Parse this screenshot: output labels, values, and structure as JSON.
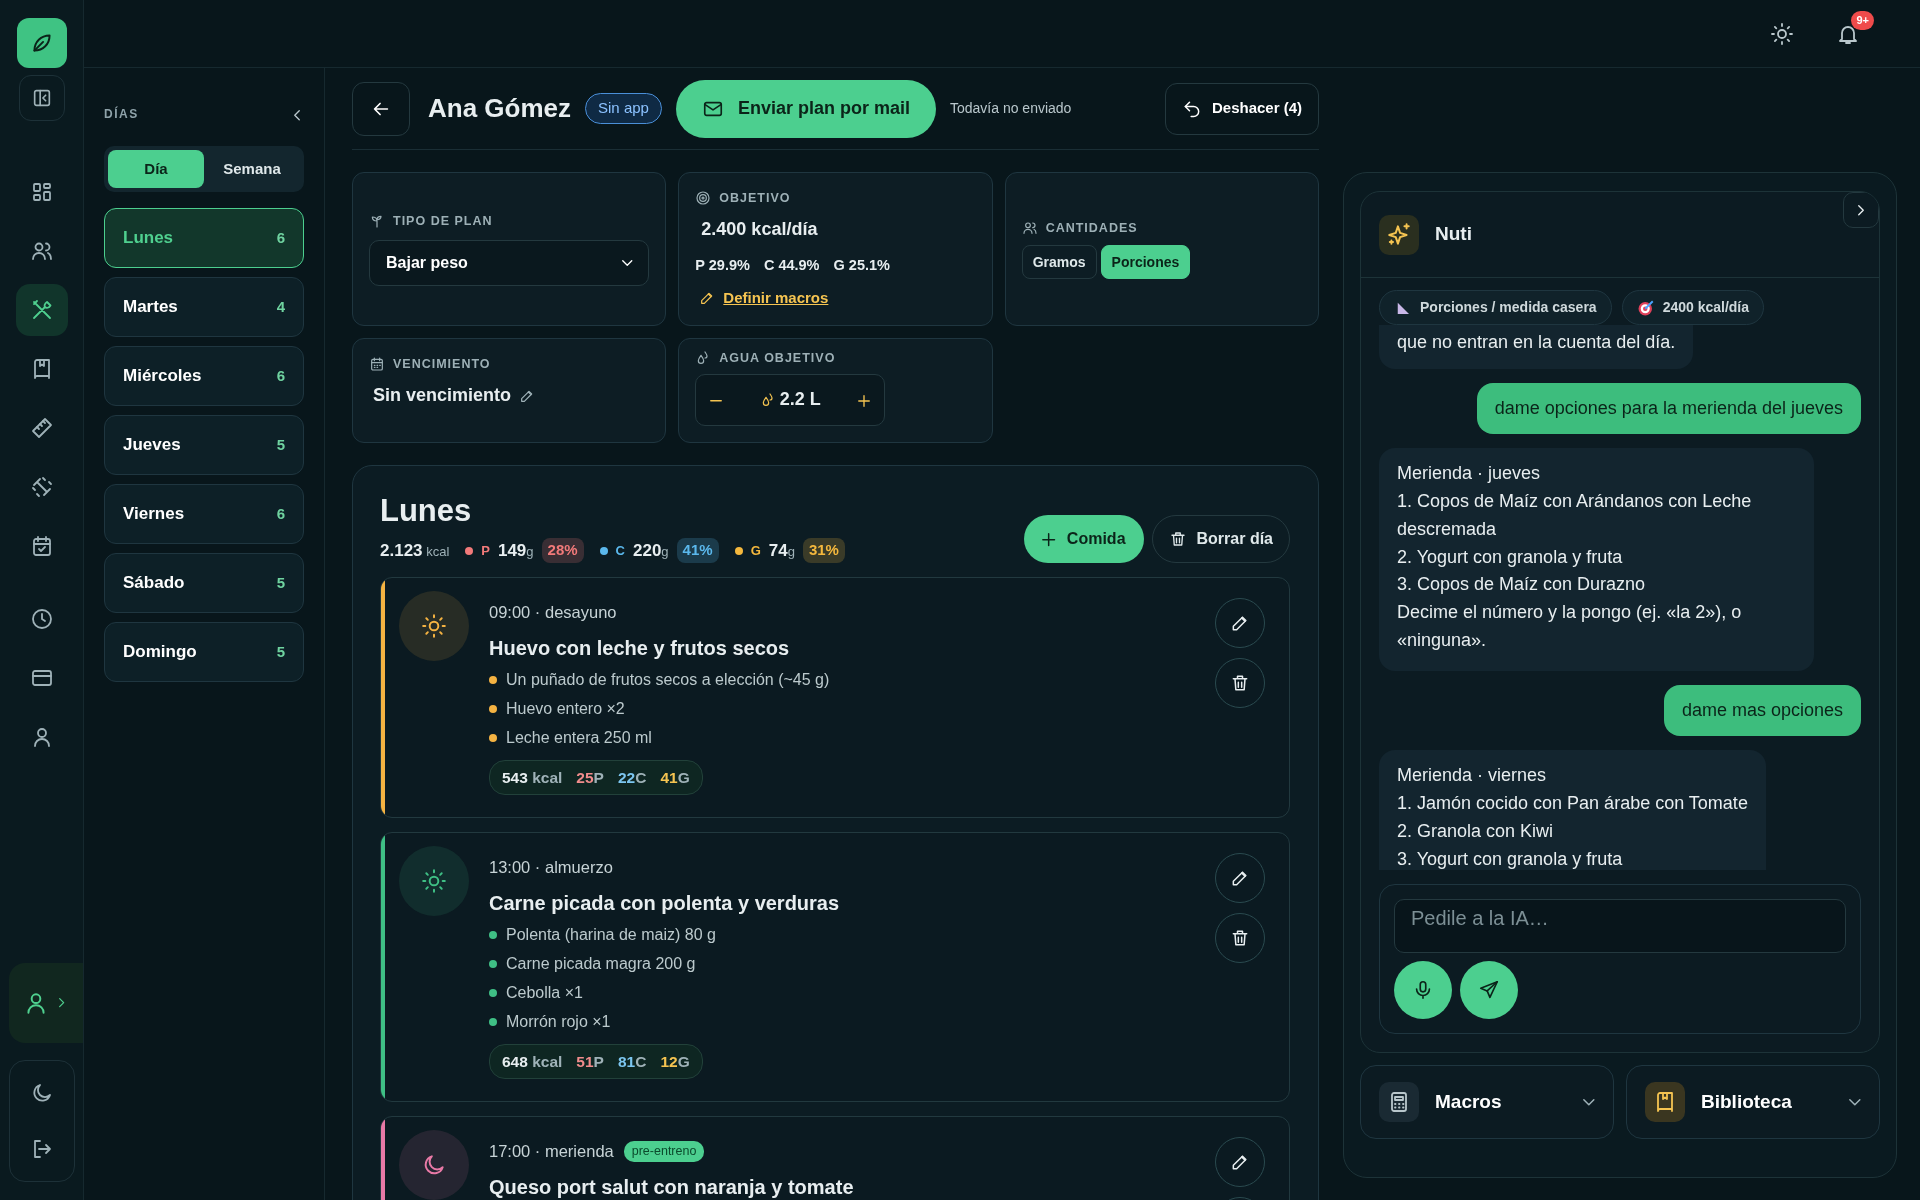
{
  "rail": {
    "items": [
      {
        "selected": false
      },
      {
        "selected": false
      },
      {
        "selected": true
      },
      {
        "selected": false
      },
      {
        "selected": false
      },
      {
        "selected": false
      },
      {
        "selected": false
      },
      {
        "selected": false
      },
      {
        "selected": false
      },
      {
        "selected": false
      }
    ]
  },
  "top_bar": {
    "notification_badge": "9+"
  },
  "days_panel": {
    "title": "DÍAS",
    "view_toggle": [
      {
        "label": "Día",
        "selected": true
      },
      {
        "label": "Semana",
        "selected": false
      }
    ],
    "days": [
      {
        "name": "Lunes",
        "count": "6",
        "selected": true
      },
      {
        "name": "Martes",
        "count": "4",
        "selected": false
      },
      {
        "name": "Miércoles",
        "count": "6",
        "selected": false
      },
      {
        "name": "Jueves",
        "count": "5",
        "selected": false
      },
      {
        "name": "Viernes",
        "count": "6",
        "selected": false
      },
      {
        "name": "Sábado",
        "count": "5",
        "selected": false
      },
      {
        "name": "Domingo",
        "count": "5",
        "selected": false
      }
    ]
  },
  "header": {
    "client_name": "Ana Gómez",
    "app_badge": "Sin app",
    "send_button": "Enviar plan por mail",
    "send_status": "Todavía no enviado",
    "undo_button": "Deshacer (4)"
  },
  "plan": {
    "plan_type": {
      "label": "TIPO DE PLAN",
      "value": "Bajar peso"
    },
    "objective": {
      "label": "OBJETIVO",
      "kcal": "2.400 kcal/día",
      "macros": [
        "P 29.9%",
        "C 44.9%",
        "G 25.1%"
      ],
      "link": "Definir macros"
    },
    "quantities": {
      "label": "CANTIDADES",
      "options": [
        {
          "label": "Gramos",
          "selected": false
        },
        {
          "label": "Porciones",
          "selected": true
        }
      ]
    },
    "expiry": {
      "label": "VENCIMIENTO",
      "value": "Sin vencimiento"
    },
    "water": {
      "label": "AGUA OBJETIVO",
      "value": "2.2 L"
    }
  },
  "day": {
    "title": "Lunes",
    "kcal": "2.123",
    "kcal_unit": "kcal",
    "macros": [
      {
        "letter": "P",
        "amount": "149",
        "unit": "g",
        "percent": "28%",
        "color": "#f27a7a"
      },
      {
        "letter": "C",
        "amount": "220",
        "unit": "g",
        "percent": "41%",
        "color": "#5bb8ec"
      },
      {
        "letter": "G",
        "amount": "74",
        "unit": "g",
        "percent": "31%",
        "color": "#f5b83d"
      }
    ],
    "add_button": "Comida",
    "delete_button": "Borrar día",
    "meals": [
      {
        "kind": "sun",
        "color": "#f5b342",
        "time": "09:00 · desayuno",
        "title": "Huevo con leche y frutos secos",
        "items": [
          "Un puñado de frutos secos a elección (~45 g)",
          "Huevo entero ×2",
          "Leche entera 250 ml"
        ],
        "totals": {
          "kcal": "543",
          "kcal_unit": "kcal",
          "macros": [
            {
              "value": "25",
              "letter": "P",
              "color": "#f08c8c"
            },
            {
              "value": "22",
              "letter": "C",
              "color": "#7cc6f0"
            },
            {
              "value": "41",
              "letter": "G",
              "color": "#f5c451"
            }
          ]
        }
      },
      {
        "kind": "sun",
        "color": "#3fbf85",
        "time": "13:00 · almuerzo",
        "title": "Carne picada con polenta y verduras",
        "items": [
          "Polenta (harina de maiz) 80 g",
          "Carne picada magra 200 g",
          "Cebolla ×1",
          "Morrón rojo ×1"
        ],
        "totals": {
          "kcal": "648",
          "kcal_unit": "kcal",
          "macros": [
            {
              "value": "51",
              "letter": "P",
              "color": "#f08c8c"
            },
            {
              "value": "81",
              "letter": "C",
              "color": "#7cc6f0"
            },
            {
              "value": "12",
              "letter": "G",
              "color": "#f5c451"
            }
          ]
        }
      },
      {
        "kind": "moon",
        "color": "#e879a6",
        "time": "17:00 · merienda",
        "tag": "pre-entreno",
        "title": "Queso port salut con naranja y tomate"
      }
    ]
  },
  "assistant": {
    "title": "Nuti",
    "chips": [
      "Porciones / medida casera",
      "2400 kcal/día"
    ],
    "messages": [
      {
        "kind": "assistant",
        "lines": [
          "que no entran en la cuenta del día."
        ]
      },
      {
        "kind": "user",
        "lines": [
          "dame opciones para la merienda del jueves"
        ]
      },
      {
        "kind": "assistant",
        "lines": [
          "Merienda · jueves",
          "1. Copos de Maíz con Arándanos con Leche descremada",
          "2. Yogurt con granola y fruta",
          "3. Copos de Maíz con Durazno",
          "Decime el número y la pongo (ej. «la 2»), o «ninguna»."
        ]
      },
      {
        "kind": "user",
        "lines": [
          "dame mas opciones"
        ]
      },
      {
        "kind": "assistant",
        "lines": [
          "Merienda · viernes",
          "1. Jamón cocido con Pan árabe con Tomate",
          "2. Granola con Kiwi",
          "3. Yogurt con granola y fruta"
        ]
      }
    ],
    "input": {
      "placeholder": "Pedile a la IA…"
    },
    "tools": [
      "Macros",
      "Biblioteca"
    ]
  }
}
